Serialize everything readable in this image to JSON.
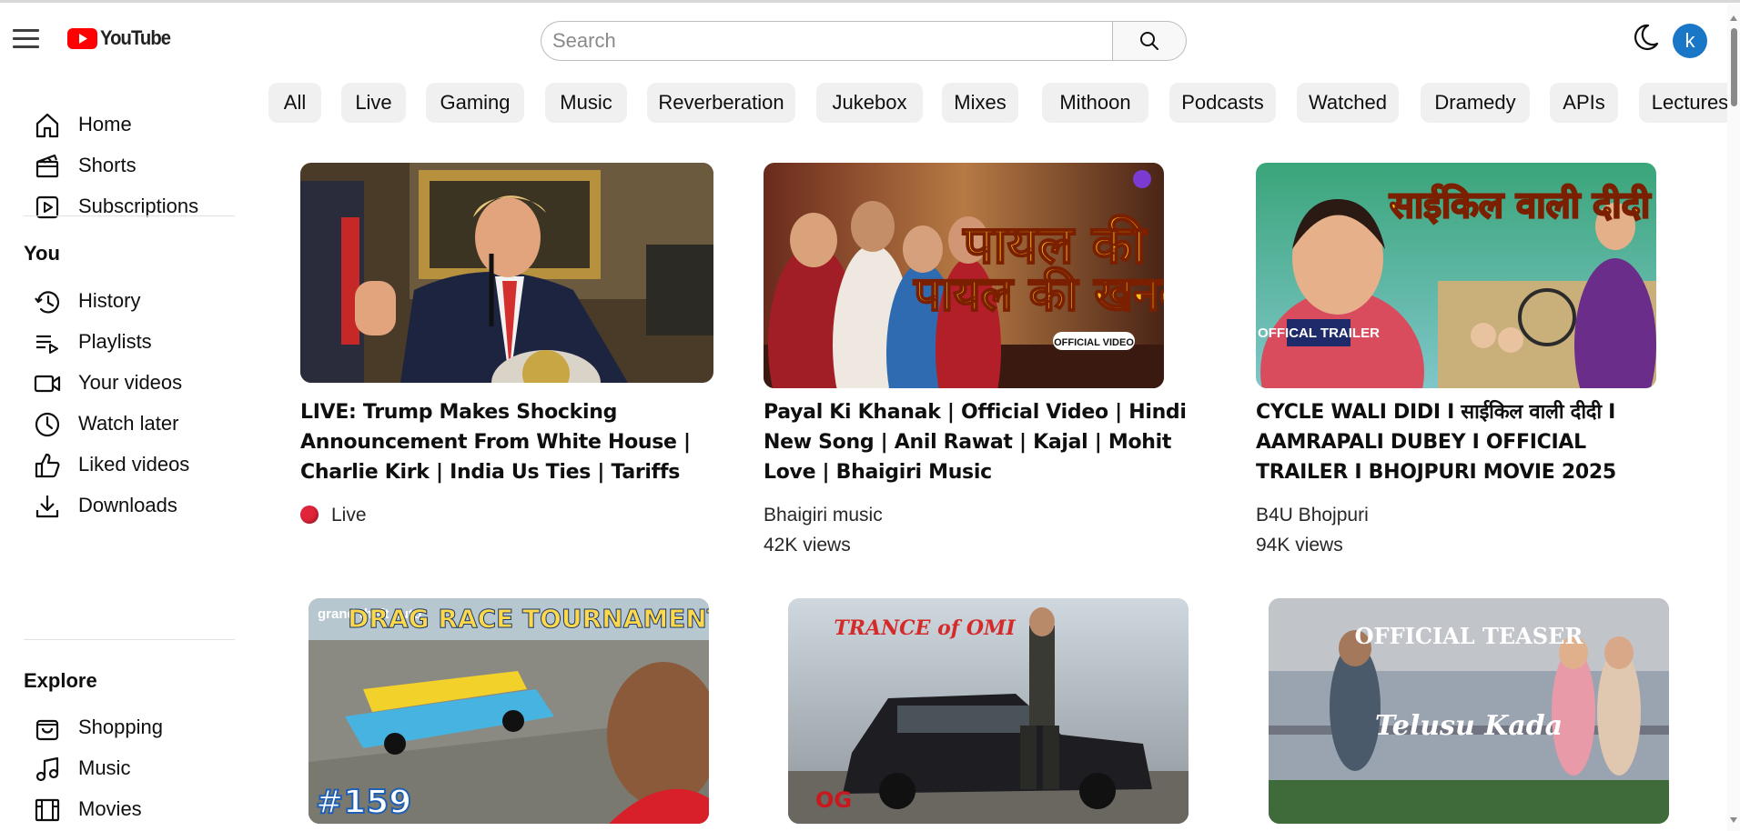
{
  "header": {
    "logo_text": "YouTube",
    "search_placeholder": "Search",
    "avatar_letter": "k"
  },
  "sidebar": {
    "main": [
      {
        "label": "Home",
        "icon": "home-icon"
      },
      {
        "label": "Shorts",
        "icon": "shorts-icon"
      },
      {
        "label": "Subscriptions",
        "icon": "subscriptions-icon"
      }
    ],
    "you_heading": "You",
    "you": [
      {
        "label": "History",
        "icon": "history-icon"
      },
      {
        "label": "Playlists",
        "icon": "playlists-icon"
      },
      {
        "label": "Your videos",
        "icon": "your-videos-icon"
      },
      {
        "label": "Watch later",
        "icon": "watch-later-icon"
      },
      {
        "label": "Liked videos",
        "icon": "liked-icon"
      },
      {
        "label": "Downloads",
        "icon": "download-icon"
      }
    ],
    "explore_heading": "Explore",
    "explore": [
      {
        "label": "Shopping",
        "icon": "shopping-icon"
      },
      {
        "label": "Music",
        "icon": "music-icon"
      },
      {
        "label": "Movies",
        "icon": "movies-icon"
      }
    ]
  },
  "chips": [
    "All",
    "Live",
    "Gaming",
    "Music",
    "Reverberation",
    "Jukebox",
    "Mixes",
    "Mithoon",
    "Podcasts",
    "Watched",
    "Dramedy",
    "APIs",
    "Lectures"
  ],
  "videos": [
    {
      "title": "LIVE: Trump Makes Shocking Announcement From White House | Charlie Kirk | India Us Ties | Tariffs",
      "channel": "",
      "live_label": "Live",
      "views": ""
    },
    {
      "title": "Payal Ki Khanak | Official Video | Hindi New Song | Anil Rawat | Kajal | Mohit Love | Bhaigiri Music",
      "channel": "Bhaigiri music",
      "views": "42K  views",
      "thumb_text": "पायल की खनक",
      "thumb_badge": "OFFICIAL VIDEO"
    },
    {
      "title": "CYCLE WALI DIDI I साईकिल वाली दीदी I AAMRAPALI DUBEY I OFFICIAL TRAILER I BHOJPURI MOVIE 2025",
      "channel": "B4U Bhojpuri",
      "views": "94K  views",
      "thumb_text": "साईकिल वाली दीदी",
      "thumb_badge": "OFFICAL TRAILER"
    },
    {
      "thumb_text": "DRAG RACE TOURNAMENT",
      "thumb_badge": "#159",
      "thumb_logo": "grand theft auto"
    },
    {
      "thumb_text": "TRANCE of OMI",
      "thumb_badge": "OG"
    },
    {
      "thumb_text": "OFFICIAL TEASER",
      "thumb_badge": "Telusu Kada"
    }
  ]
}
